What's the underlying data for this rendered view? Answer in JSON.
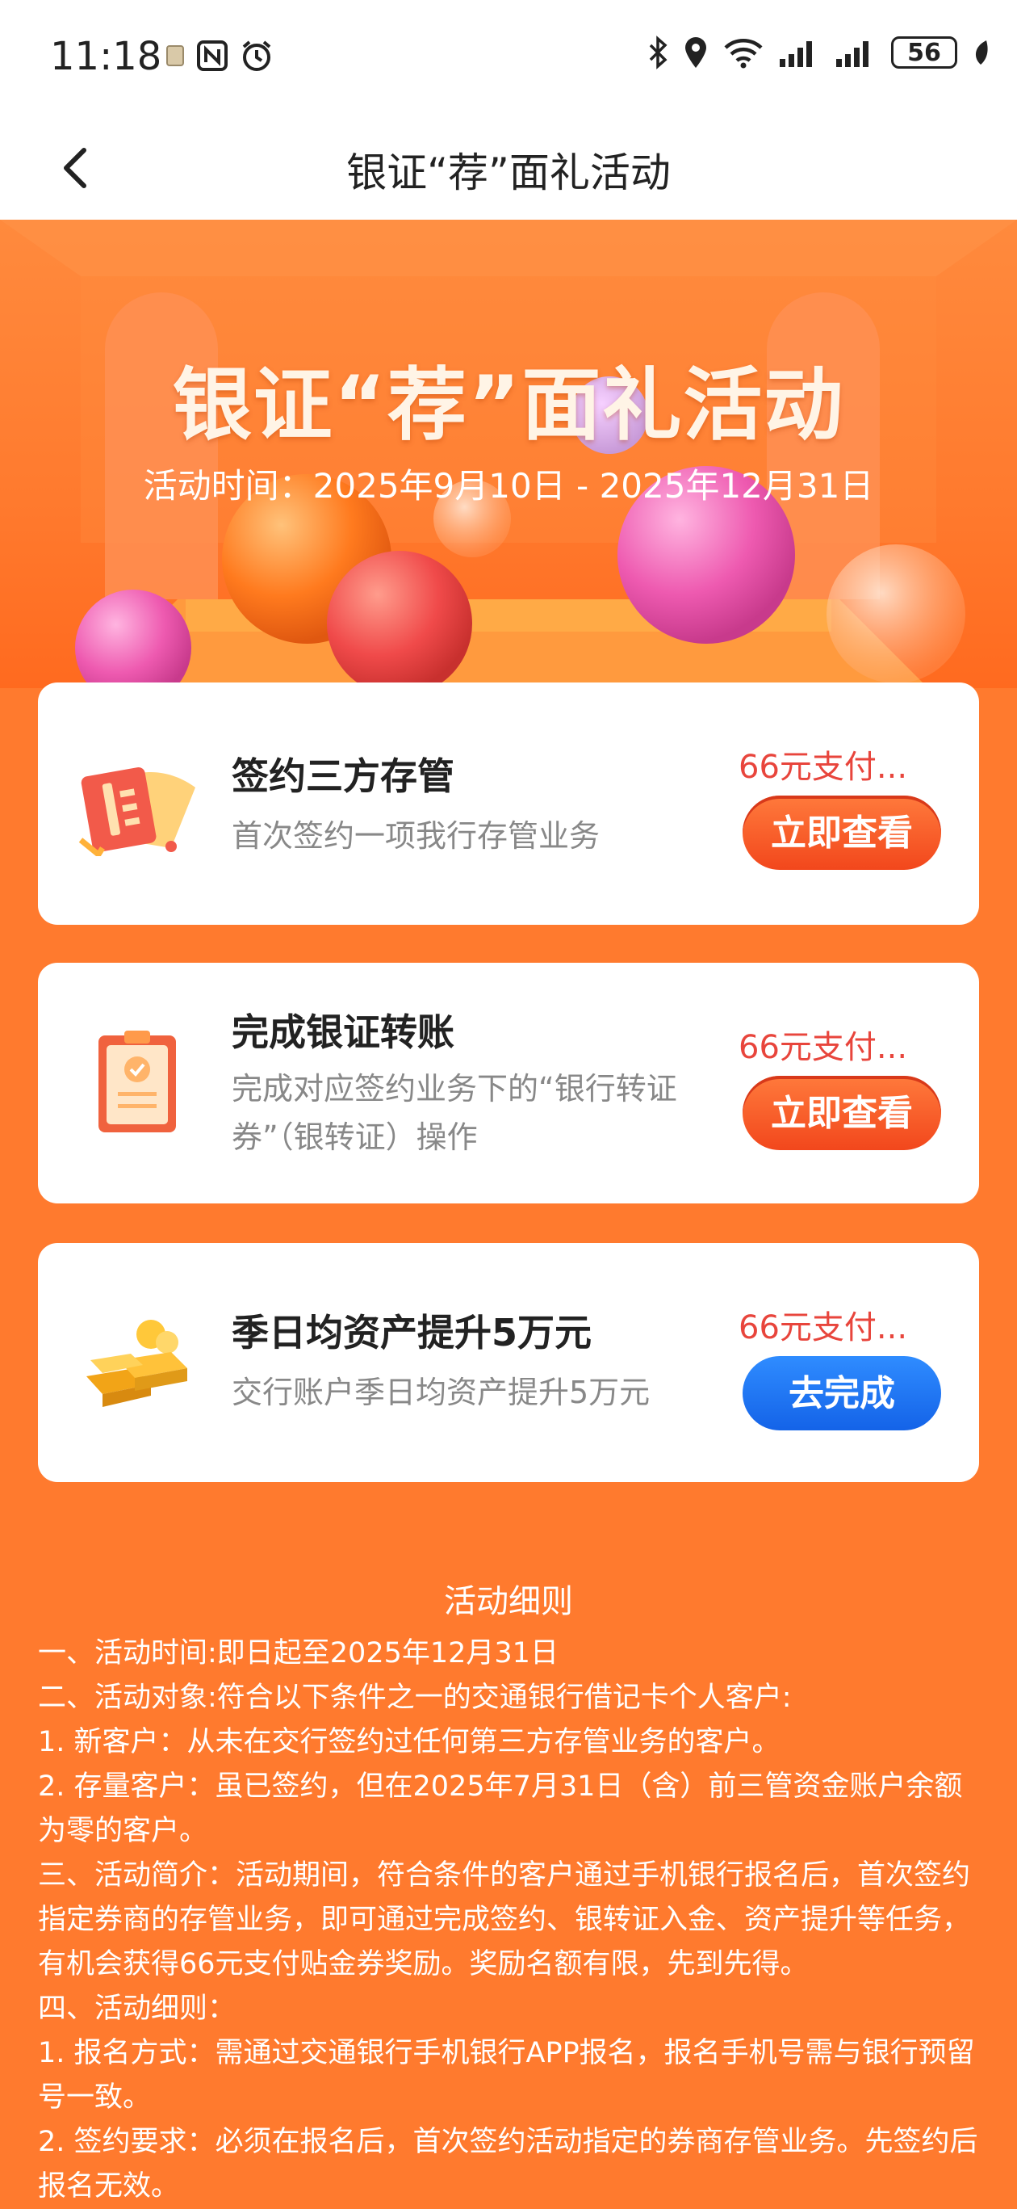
{
  "status_bar": {
    "time": "11:18",
    "battery": "56"
  },
  "nav": {
    "title": "银证“荐”面礼活动"
  },
  "hero": {
    "title": "银证“荐”面礼活动",
    "date": "活动时间：2025年9月10日 - 2025年12月31日"
  },
  "tasks": [
    {
      "title": "签约三方存管",
      "desc": "首次签约一项我行存管业务",
      "reward": "66元支付...",
      "button": "立即查看",
      "icon": "card-contract-icon"
    },
    {
      "title": "完成银证转账",
      "desc": "完成对应签约业务下的“银行转证券”（银转证）操作",
      "reward": "66元支付...",
      "button": "立即查看",
      "icon": "clipboard-icon"
    },
    {
      "title": "季日均资产提升5万元",
      "desc": "交行账户季日均资产提升5万元",
      "reward": "66元支付...",
      "button": "去完成",
      "icon": "gold-bars-icon"
    }
  ],
  "rules": {
    "title": "活动细则",
    "lines": [
      "一、活动时间:即日起至2025年12月31日",
      "二、活动对象:符合以下条件之一的交通银行借记卡个人客户:",
      "1. 新客户：从未在交行签约过任何第三方存管业务的客户。",
      "2. 存量客户：虽已签约，但在2025年7月31日（含）前三管资金账户余额为零的客户。",
      "三、活动简介：活动期间，符合条件的客户通过手机银行报名后，首次签约指定券商的存管业务，即可通过完成签约、银转证入金、资产提升等任务，有机会获得66元支付贴金券奖励。奖励名额有限，先到先得。",
      "四、活动细则：",
      "1. 报名方式：需通过交通银行手机银行APP报名，报名手机号需与银行预留号一致。",
      "2. 签约要求：必须在报名后，首次签约活动指定的券商存管业务。先签约后报名无效。"
    ]
  },
  "colors": {
    "background": "#FF7A2E",
    "reward_text": "#E8453C",
    "button_orange": "#F2471C",
    "button_blue": "#1463E8"
  }
}
